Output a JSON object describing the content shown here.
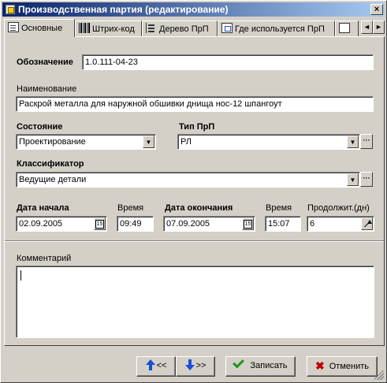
{
  "window": {
    "title": "Производственная партия (редактирование)",
    "close_label": "×"
  },
  "tabs": [
    {
      "label": "Основные",
      "icon": "document-icon"
    },
    {
      "label": "Штрих-код",
      "icon": "barcode-icon"
    },
    {
      "label": "Дерево ПрП",
      "icon": "tree-icon"
    },
    {
      "label": "Где используется ПрП",
      "icon": "where-used-icon"
    }
  ],
  "tab_scroll": {
    "left": "◄",
    "right": "►"
  },
  "form": {
    "designation_label": "Обозначение",
    "designation_value": "1.0.111-04-23",
    "name_label": "Наименование",
    "name_value": "Раскрой металла для наружной обшивки днища нос-12 шпангоут",
    "state_label": "Состояние",
    "state_value": "Проектирование",
    "type_label": "Тип ПрП",
    "type_value": "РЛ",
    "classifier_label": "Классификатор",
    "classifier_value": "Ведущие детали",
    "start_date_label": "Дата начала",
    "start_date_value": "02.09.2005",
    "start_time_label": "Время",
    "start_time_value": "09:49",
    "end_date_label": "Дата окончания",
    "end_date_value": "07.09.2005",
    "end_time_label": "Время",
    "end_time_value": "15:07",
    "duration_label": "Продолжит.(дн)",
    "duration_value": "6",
    "calendar_label": "15",
    "comment_label": "Комментарий",
    "comment_value": ""
  },
  "buttons": {
    "prev_label": "<<",
    "next_label": ">>",
    "save_label": "Записать",
    "cancel_label": "Отменить"
  },
  "colors": {
    "titlebar_start": "#0a246a",
    "titlebar_end": "#a6caf0",
    "window_bg": "#d4d0c8",
    "save_icon": "#1a9a1a",
    "cancel_icon": "#c00000",
    "nav_arrow": "#1c4fd8"
  }
}
